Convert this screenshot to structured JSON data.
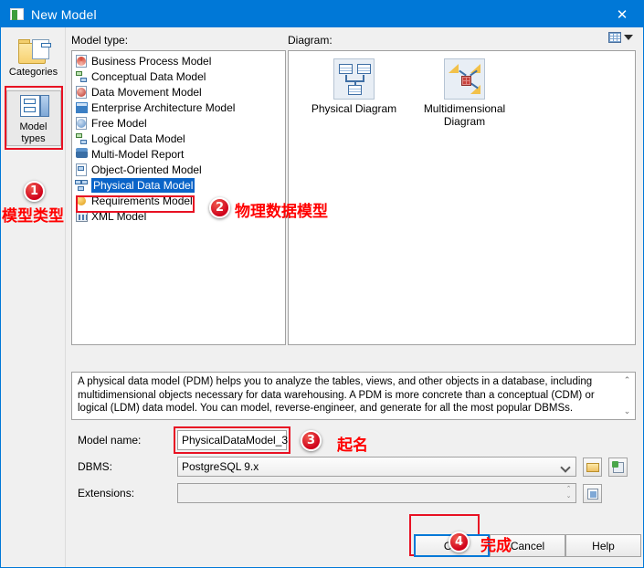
{
  "window": {
    "title": "New Model",
    "title_icon": "model-icon",
    "close_icon": "✕"
  },
  "rail": {
    "items": [
      {
        "label": "Categories",
        "icon": "categories-folder-icon",
        "selected": false
      },
      {
        "label": "Model types",
        "icon": "model-types-icon",
        "selected": true
      }
    ]
  },
  "labels": {
    "model_type": "Model type:",
    "diagram": "Diagram:"
  },
  "model_types": {
    "items": [
      {
        "label": "Business Process Model",
        "icon": "business-process-icon",
        "selected": false
      },
      {
        "label": "Conceptual Data Model",
        "icon": "conceptual-data-icon",
        "selected": false
      },
      {
        "label": "Data Movement Model",
        "icon": "data-movement-icon",
        "selected": false
      },
      {
        "label": "Enterprise Architecture Model",
        "icon": "enterprise-architecture-icon",
        "selected": false
      },
      {
        "label": "Free Model",
        "icon": "free-model-icon",
        "selected": false
      },
      {
        "label": "Logical Data Model",
        "icon": "logical-data-icon",
        "selected": false
      },
      {
        "label": "Multi-Model Report",
        "icon": "multi-model-report-icon",
        "selected": false
      },
      {
        "label": "Object-Oriented Model",
        "icon": "object-oriented-icon",
        "selected": false
      },
      {
        "label": "Physical Data Model",
        "icon": "physical-data-icon",
        "selected": true
      },
      {
        "label": "Requirements Model",
        "icon": "requirements-icon",
        "selected": false
      },
      {
        "label": "XML Model",
        "icon": "xml-model-icon",
        "selected": false
      }
    ]
  },
  "diagram": {
    "view_toggle_icon": "grid-view-icon",
    "view_toggle_caret": "chevron-down-icon",
    "items": [
      {
        "label": "Physical Diagram",
        "icon": "physical-diagram-icon"
      },
      {
        "label": "Multidimensional Diagram",
        "icon": "multidimensional-diagram-icon"
      }
    ]
  },
  "description": {
    "text": "A physical data model (PDM) helps you to analyze the tables, views, and other objects in a database, including multidimensional objects necessary for data warehousing. A PDM is more concrete than a conceptual (CDM) or logical (LDM) data model. You can model, reverse-engineer, and generate for all the most popular DBMSs.",
    "scroll_up": "⌃",
    "scroll_down": "⌄"
  },
  "form": {
    "model_name_label": "Model name:",
    "model_name_value": "PhysicalDataModel_3",
    "dbms_label": "DBMS:",
    "dbms_value": "PostgreSQL 9.x",
    "extensions_label": "Extensions:",
    "extensions_value": "",
    "dbms_browse_icon": "folder-icon",
    "dbms_add_icon": "add-dbms-icon",
    "extensions_properties_icon": "properties-icon"
  },
  "buttons": {
    "ok": "OK",
    "cancel": "Cancel",
    "help": "Help"
  },
  "annotations": [
    {
      "number": "1",
      "text": "模型类型"
    },
    {
      "number": "2",
      "text": "物理数据模型"
    },
    {
      "number": "3",
      "text": "起名"
    },
    {
      "number": "4",
      "text": "完成"
    }
  ],
  "colors": {
    "title_bar": "#0078d7",
    "selection": "#0a64c8",
    "annotation_red": "#ff0000",
    "badge_red": "#d0021b"
  }
}
